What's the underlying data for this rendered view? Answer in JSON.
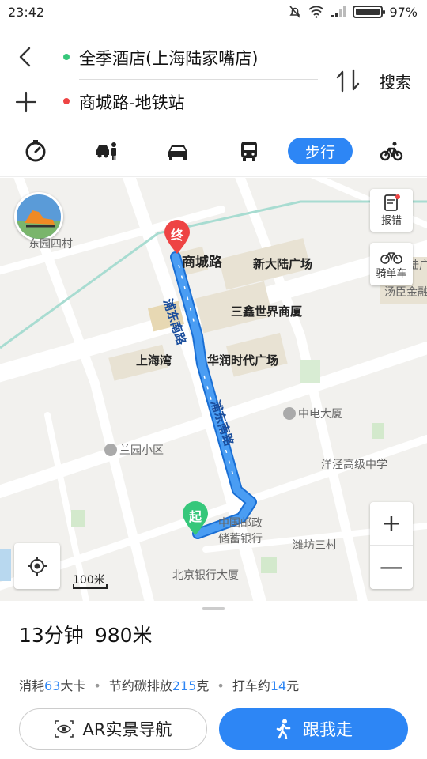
{
  "status_bar": {
    "time": "23:42",
    "battery_percent": "97%",
    "battery_level": 0.97,
    "icons": [
      "mute-icon",
      "wifi-icon",
      "signal-icon",
      "battery-icon"
    ]
  },
  "route": {
    "start": "全季酒店(上海陆家嘴店)",
    "end": "商城路-地铁站",
    "search_label": "搜索"
  },
  "modes": {
    "items": [
      "taxi-icon",
      "drive-and-ride-icon",
      "car-icon",
      "bus-icon",
      "walk",
      "bike-icon"
    ],
    "active_label": "步行"
  },
  "map": {
    "labels": {
      "dongyuan": "东园四村",
      "shangchenglu": "商城路",
      "xindalu": "新大陆广场",
      "sanxin": "三鑫世界商厦",
      "shanghaiwan": "上海湾",
      "huarun": "华润时代广场",
      "pudong_road_1": "浦东南路",
      "pudong_road_2": "浦东南路",
      "zhongdian": "中电大厦",
      "lanyuan": "兰园小区",
      "yangjing": "洋泾高级中学",
      "post_bank_1": "中国邮政",
      "post_bank_2": "储蓄银行",
      "weifang": "潍坊三村",
      "bj_bank": "北京银行大厦",
      "lu_edge": "陆广",
      "tangchen": "汤臣金融"
    },
    "markers": {
      "end": "终",
      "start": "起"
    },
    "buttons": {
      "report": "报错",
      "bike": "骑单车",
      "zoom_in": "+",
      "zoom_out": "—"
    },
    "scale": "100米"
  },
  "summary": {
    "duration": "13分钟",
    "distance": "980米"
  },
  "stats": {
    "calorie_prefix": "消耗",
    "calorie_value": "63",
    "calorie_unit": "大卡",
    "carbon_prefix": "节约碳排放",
    "carbon_value": "215",
    "carbon_unit": "克",
    "taxi_prefix": "打车约",
    "taxi_value": "14",
    "taxi_unit": "元"
  },
  "actions": {
    "ar_label": "AR实景导航",
    "follow_label": "跟我走"
  },
  "colors": {
    "accent": "#2d86f5",
    "start_dot": "#36c77a",
    "end_dot": "#ee4444",
    "route_line": "#4a9df3"
  }
}
